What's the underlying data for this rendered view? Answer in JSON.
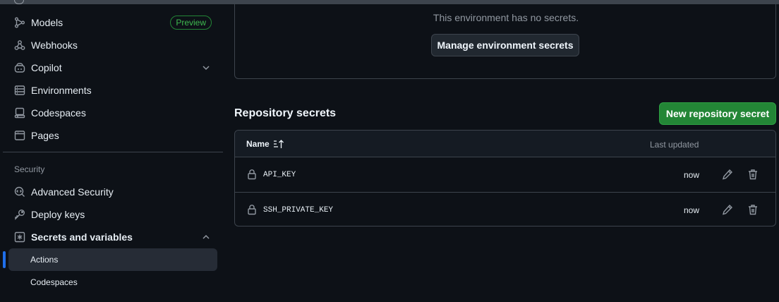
{
  "sidebar": {
    "items": [
      {
        "label": "Models",
        "icon": "models-icon",
        "badge": "Preview"
      },
      {
        "label": "Webhooks",
        "icon": "webhook-icon"
      },
      {
        "label": "Copilot",
        "icon": "copilot-icon",
        "expandable": true
      },
      {
        "label": "Environments",
        "icon": "server-icon"
      },
      {
        "label": "Codespaces",
        "icon": "codespaces-icon"
      },
      {
        "label": "Pages",
        "icon": "browser-icon"
      }
    ],
    "security_heading": "Security",
    "security_items": [
      {
        "label": "Advanced Security",
        "icon": "codescan-icon"
      },
      {
        "label": "Deploy keys",
        "icon": "key-icon"
      },
      {
        "label": "Secrets and variables",
        "icon": "asterisk-icon",
        "expanded": true
      }
    ],
    "sub_items": [
      {
        "label": "Actions",
        "active": true
      },
      {
        "label": "Codespaces"
      }
    ]
  },
  "environment": {
    "message": "This environment has no secrets.",
    "manage_button": "Manage environment secrets"
  },
  "repo_secrets": {
    "title": "Repository secrets",
    "new_button": "New repository secret",
    "columns": {
      "name": "Name",
      "updated": "Last updated"
    },
    "rows": [
      {
        "name": "API_KEY",
        "updated": "now"
      },
      {
        "name": "SSH_PRIVATE_KEY",
        "updated": "now"
      }
    ]
  },
  "colors": {
    "background": "#0d1117",
    "border": "#3d444d",
    "accent_blue": "#1f6feb",
    "primary_green": "#238636",
    "badge_green": "#3fb950"
  }
}
